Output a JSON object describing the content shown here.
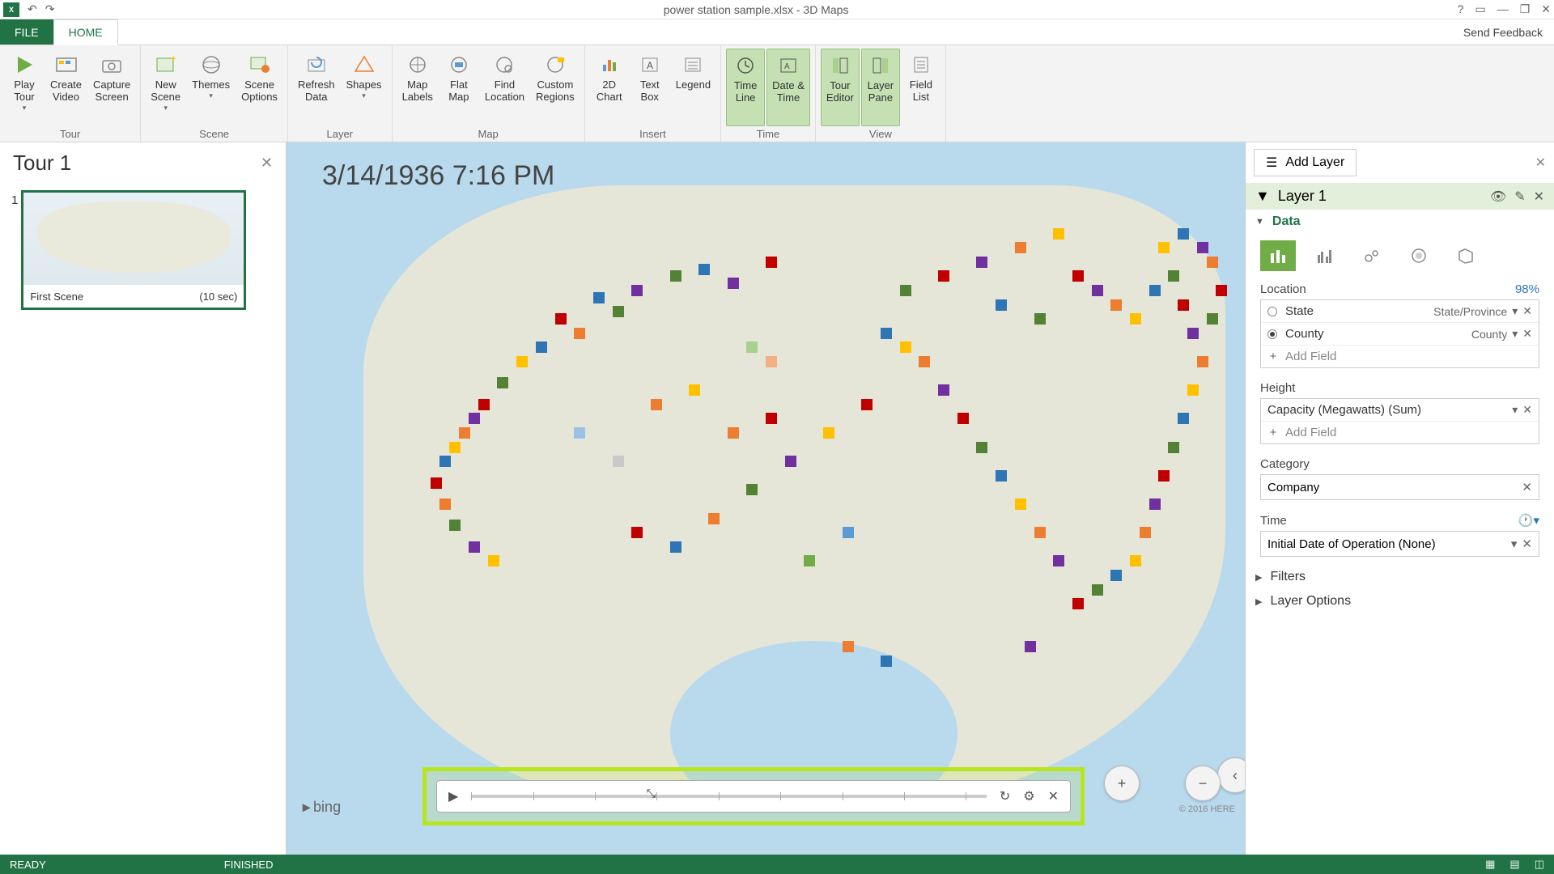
{
  "titlebar": {
    "app": "X",
    "title": "power station sample.xlsx - 3D Maps"
  },
  "tabs": {
    "file": "FILE",
    "home": "HOME",
    "feedback": "Send Feedback"
  },
  "ribbon": {
    "tour": {
      "label": "Tour",
      "play": "Play\nTour",
      "create_video": "Create\nVideo",
      "capture_screen": "Capture\nScreen"
    },
    "scene": {
      "label": "Scene",
      "new_scene": "New\nScene",
      "themes": "Themes",
      "scene_options": "Scene\nOptions"
    },
    "layer": {
      "label": "Layer",
      "refresh_data": "Refresh\nData",
      "shapes": "Shapes"
    },
    "map": {
      "label": "Map",
      "map_labels": "Map\nLabels",
      "flat_map": "Flat\nMap",
      "find_location": "Find\nLocation",
      "custom_regions": "Custom\nRegions"
    },
    "insert": {
      "label": "Insert",
      "chart2d": "2D\nChart",
      "text_box": "Text\nBox",
      "legend": "Legend"
    },
    "time": {
      "label": "Time",
      "time_line": "Time\nLine",
      "date_time": "Date &\nTime"
    },
    "view": {
      "label": "View",
      "tour_editor": "Tour\nEditor",
      "layer_pane": "Layer\nPane",
      "field_list": "Field\nList"
    }
  },
  "tour_panel": {
    "title": "Tour 1",
    "scenes": [
      {
        "name": "First Scene",
        "duration": "(10 sec)"
      }
    ]
  },
  "map": {
    "timestamp": "3/14/1936 7:16 PM",
    "bing": "bing",
    "copyright": "© 2016 HERE"
  },
  "layer_pane": {
    "add_layer": "Add Layer",
    "layer_name": "Layer 1",
    "data_label": "Data",
    "location": {
      "label": "Location",
      "pct": "98%",
      "rows": [
        {
          "field": "State",
          "type": "State/Province",
          "checked": false
        },
        {
          "field": "County",
          "type": "County",
          "checked": true
        }
      ],
      "add_field": "Add Field"
    },
    "height": {
      "label": "Height",
      "field": "Capacity (Megawatts) (Sum)",
      "add_field": "Add Field"
    },
    "category": {
      "label": "Category",
      "field": "Company"
    },
    "time": {
      "label": "Time",
      "field": "Initial Date of Operation (None)"
    },
    "filters": "Filters",
    "layer_options": "Layer Options"
  },
  "statusbar": {
    "ready": "READY",
    "finished": "FINISHED"
  },
  "data_points": [
    {
      "x": 32,
      "y": 21,
      "c": "#2e75b6"
    },
    {
      "x": 34,
      "y": 23,
      "c": "#548235"
    },
    {
      "x": 36,
      "y": 20,
      "c": "#7030a0"
    },
    {
      "x": 28,
      "y": 24,
      "c": "#c00000"
    },
    {
      "x": 30,
      "y": 26,
      "c": "#ed7d31"
    },
    {
      "x": 26,
      "y": 28,
      "c": "#2e75b6"
    },
    {
      "x": 24,
      "y": 30,
      "c": "#ffc000"
    },
    {
      "x": 22,
      "y": 33,
      "c": "#548235"
    },
    {
      "x": 20,
      "y": 36,
      "c": "#c00000"
    },
    {
      "x": 19,
      "y": 38,
      "c": "#7030a0"
    },
    {
      "x": 18,
      "y": 40,
      "c": "#ed7d31"
    },
    {
      "x": 17,
      "y": 42,
      "c": "#ffc000"
    },
    {
      "x": 16,
      "y": 44,
      "c": "#2e75b6"
    },
    {
      "x": 15,
      "y": 47,
      "c": "#c00000"
    },
    {
      "x": 16,
      "y": 50,
      "c": "#ed7d31"
    },
    {
      "x": 17,
      "y": 53,
      "c": "#548235"
    },
    {
      "x": 19,
      "y": 56,
      "c": "#7030a0"
    },
    {
      "x": 21,
      "y": 58,
      "c": "#ffc000"
    },
    {
      "x": 40,
      "y": 18,
      "c": "#548235"
    },
    {
      "x": 43,
      "y": 17,
      "c": "#2e75b6"
    },
    {
      "x": 46,
      "y": 19,
      "c": "#7030a0"
    },
    {
      "x": 50,
      "y": 16,
      "c": "#c00000"
    },
    {
      "x": 38,
      "y": 36,
      "c": "#ed7d31"
    },
    {
      "x": 42,
      "y": 34,
      "c": "#ffc000"
    },
    {
      "x": 36,
      "y": 54,
      "c": "#c00000"
    },
    {
      "x": 40,
      "y": 56,
      "c": "#2e75b6"
    },
    {
      "x": 44,
      "y": 52,
      "c": "#ed7d31"
    },
    {
      "x": 48,
      "y": 48,
      "c": "#548235"
    },
    {
      "x": 52,
      "y": 44,
      "c": "#7030a0"
    },
    {
      "x": 56,
      "y": 40,
      "c": "#ffc000"
    },
    {
      "x": 60,
      "y": 36,
      "c": "#c00000"
    },
    {
      "x": 58,
      "y": 70,
      "c": "#ed7d31"
    },
    {
      "x": 62,
      "y": 72,
      "c": "#2e75b6"
    },
    {
      "x": 64,
      "y": 20,
      "c": "#548235"
    },
    {
      "x": 68,
      "y": 18,
      "c": "#c00000"
    },
    {
      "x": 72,
      "y": 16,
      "c": "#7030a0"
    },
    {
      "x": 76,
      "y": 14,
      "c": "#ed7d31"
    },
    {
      "x": 80,
      "y": 12,
      "c": "#ffc000"
    },
    {
      "x": 74,
      "y": 22,
      "c": "#2e75b6"
    },
    {
      "x": 78,
      "y": 24,
      "c": "#548235"
    },
    {
      "x": 82,
      "y": 18,
      "c": "#c00000"
    },
    {
      "x": 84,
      "y": 20,
      "c": "#7030a0"
    },
    {
      "x": 86,
      "y": 22,
      "c": "#ed7d31"
    },
    {
      "x": 88,
      "y": 24,
      "c": "#ffc000"
    },
    {
      "x": 90,
      "y": 20,
      "c": "#2e75b6"
    },
    {
      "x": 92,
      "y": 18,
      "c": "#548235"
    },
    {
      "x": 93,
      "y": 22,
      "c": "#c00000"
    },
    {
      "x": 94,
      "y": 26,
      "c": "#7030a0"
    },
    {
      "x": 95,
      "y": 30,
      "c": "#ed7d31"
    },
    {
      "x": 94,
      "y": 34,
      "c": "#ffc000"
    },
    {
      "x": 93,
      "y": 38,
      "c": "#2e75b6"
    },
    {
      "x": 92,
      "y": 42,
      "c": "#548235"
    },
    {
      "x": 91,
      "y": 46,
      "c": "#c00000"
    },
    {
      "x": 90,
      "y": 50,
      "c": "#7030a0"
    },
    {
      "x": 89,
      "y": 54,
      "c": "#ed7d31"
    },
    {
      "x": 88,
      "y": 58,
      "c": "#ffc000"
    },
    {
      "x": 86,
      "y": 60,
      "c": "#2e75b6"
    },
    {
      "x": 84,
      "y": 62,
      "c": "#548235"
    },
    {
      "x": 82,
      "y": 64,
      "c": "#c00000"
    },
    {
      "x": 80,
      "y": 58,
      "c": "#7030a0"
    },
    {
      "x": 78,
      "y": 54,
      "c": "#ed7d31"
    },
    {
      "x": 76,
      "y": 50,
      "c": "#ffc000"
    },
    {
      "x": 74,
      "y": 46,
      "c": "#2e75b6"
    },
    {
      "x": 72,
      "y": 42,
      "c": "#548235"
    },
    {
      "x": 70,
      "y": 38,
      "c": "#c00000"
    },
    {
      "x": 68,
      "y": 34,
      "c": "#7030a0"
    },
    {
      "x": 66,
      "y": 30,
      "c": "#ed7d31"
    },
    {
      "x": 64,
      "y": 28,
      "c": "#ffc000"
    },
    {
      "x": 62,
      "y": 26,
      "c": "#2e75b6"
    },
    {
      "x": 48,
      "y": 28,
      "c": "#a9d08e"
    },
    {
      "x": 50,
      "y": 30,
      "c": "#f4b084"
    },
    {
      "x": 30,
      "y": 40,
      "c": "#9bc2e6"
    },
    {
      "x": 34,
      "y": 44,
      "c": "#c9c9c9"
    },
    {
      "x": 54,
      "y": 58,
      "c": "#70ad47"
    },
    {
      "x": 58,
      "y": 54,
      "c": "#5b9bd5"
    },
    {
      "x": 96,
      "y": 16,
      "c": "#ed7d31"
    },
    {
      "x": 97,
      "y": 20,
      "c": "#c00000"
    },
    {
      "x": 96,
      "y": 24,
      "c": "#548235"
    },
    {
      "x": 95,
      "y": 14,
      "c": "#7030a0"
    },
    {
      "x": 93,
      "y": 12,
      "c": "#2e75b6"
    },
    {
      "x": 91,
      "y": 14,
      "c": "#ffc000"
    },
    {
      "x": 77,
      "y": 70,
      "c": "#7030a0"
    },
    {
      "x": 46,
      "y": 40,
      "c": "#ed7d31"
    },
    {
      "x": 50,
      "y": 38,
      "c": "#c00000"
    }
  ]
}
